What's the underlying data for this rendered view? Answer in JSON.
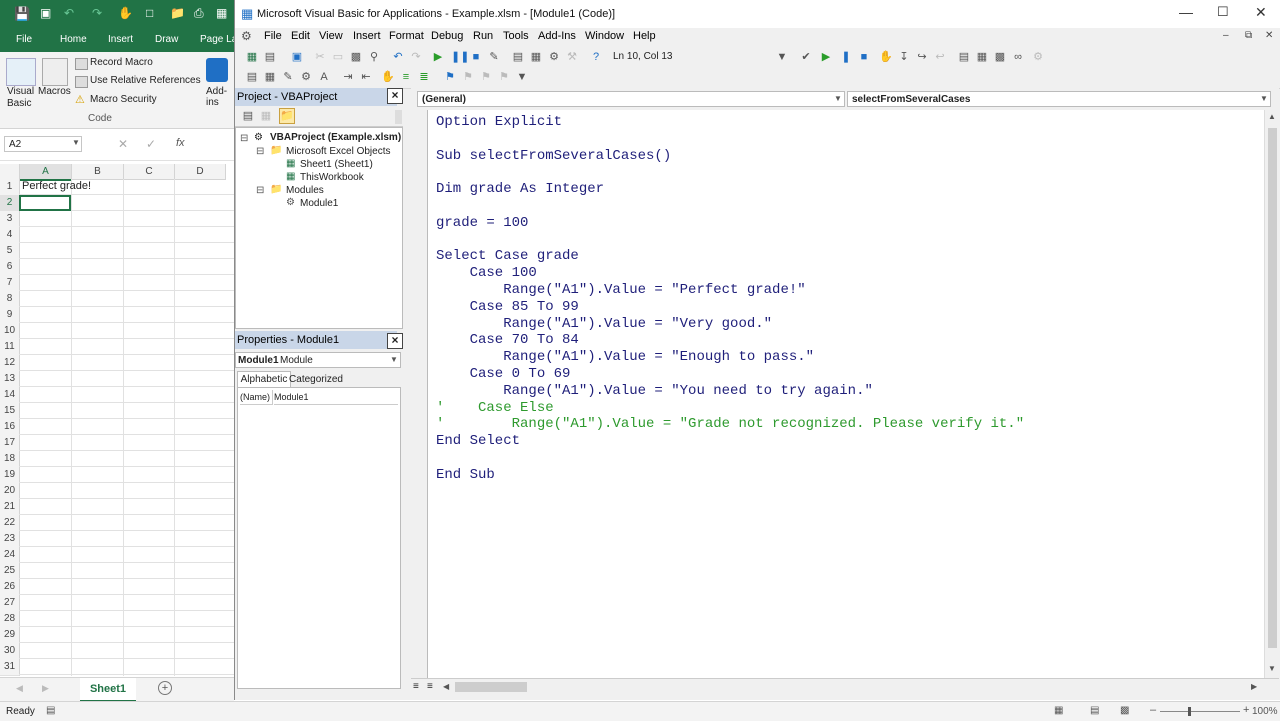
{
  "excel": {
    "ribbon_tabs": [
      "File",
      "Home",
      "Insert",
      "Draw",
      "Page La"
    ],
    "code_group": {
      "visual_basic": "Visual Basic",
      "macros": "Macros",
      "record_macro": "Record Macro",
      "use_relative": "Use Relative References",
      "macro_security": "Macro Security",
      "addins": "Add-ins",
      "group_label": "Code"
    },
    "name_box": "A2",
    "fx": "fx",
    "columns": [
      "A",
      "B",
      "C",
      "D"
    ],
    "rows": [
      "1",
      "2",
      "3",
      "4",
      "5",
      "6",
      "7",
      "8",
      "9",
      "10",
      "11",
      "12",
      "13",
      "14",
      "15",
      "16",
      "17",
      "18",
      "19",
      "20",
      "21",
      "22",
      "23",
      "24",
      "25",
      "26",
      "27",
      "28",
      "29",
      "30",
      "31"
    ],
    "cell_a1": "Perfect grade!",
    "sheet_tab": "Sheet1",
    "status": "Ready",
    "zoom": "100%"
  },
  "vbe": {
    "title": "Microsoft Visual Basic for Applications - Example.xlsm - [Module1 (Code)]",
    "menu": [
      "File",
      "Edit",
      "View",
      "Insert",
      "Format",
      "Debug",
      "Run",
      "Tools",
      "Add-Ins",
      "Window",
      "Help"
    ],
    "position": "Ln 10, Col 13",
    "project_title": "Project - VBAProject",
    "tree": {
      "root": "VBAProject (Example.xlsm)",
      "excel_objects": "Microsoft Excel Objects",
      "sheet1": "Sheet1 (Sheet1)",
      "workbook": "ThisWorkbook",
      "modules": "Modules",
      "module1": "Module1"
    },
    "properties_title": "Properties - Module1",
    "properties_object": "Module1",
    "properties_type": "Module",
    "tab_alpha": "Alphabetic",
    "tab_cat": "Categorized",
    "prop_name_key": "(Name)",
    "prop_name_val": "Module1",
    "object_dropdown": "(General)",
    "proc_dropdown": "selectFromSeveralCases",
    "code": [
      {
        "text": "Option Explicit",
        "comment": false
      },
      {
        "text": "",
        "comment": false
      },
      {
        "text": "Sub selectFromSeveralCases()",
        "comment": false
      },
      {
        "text": "",
        "comment": false
      },
      {
        "text": "Dim grade As Integer",
        "comment": false
      },
      {
        "text": "",
        "comment": false
      },
      {
        "text": "grade = 100",
        "comment": false
      },
      {
        "text": "",
        "comment": false
      },
      {
        "text": "Select Case grade",
        "comment": false
      },
      {
        "text": "    Case 100",
        "comment": false
      },
      {
        "text": "        Range(\"A1\").Value = \"Perfect grade!\"",
        "comment": false
      },
      {
        "text": "    Case 85 To 99",
        "comment": false
      },
      {
        "text": "        Range(\"A1\").Value = \"Very good.\"",
        "comment": false
      },
      {
        "text": "    Case 70 To 84",
        "comment": false
      },
      {
        "text": "        Range(\"A1\").Value = \"Enough to pass.\"",
        "comment": false
      },
      {
        "text": "    Case 0 To 69",
        "comment": false
      },
      {
        "text": "        Range(\"A1\").Value = \"You need to try again.\"",
        "comment": false
      },
      {
        "text": "'    Case Else",
        "comment": true
      },
      {
        "text": "'        Range(\"A1\").Value = \"Grade not recognized. Please verify it.\"",
        "comment": true
      },
      {
        "text": "End Select",
        "comment": false
      },
      {
        "text": "",
        "comment": false
      },
      {
        "text": "End Sub",
        "comment": false
      }
    ]
  },
  "colors": {
    "excel_green": "#217346",
    "code_blue": "#1f1f7a",
    "comment_green": "#2e9a2e"
  }
}
